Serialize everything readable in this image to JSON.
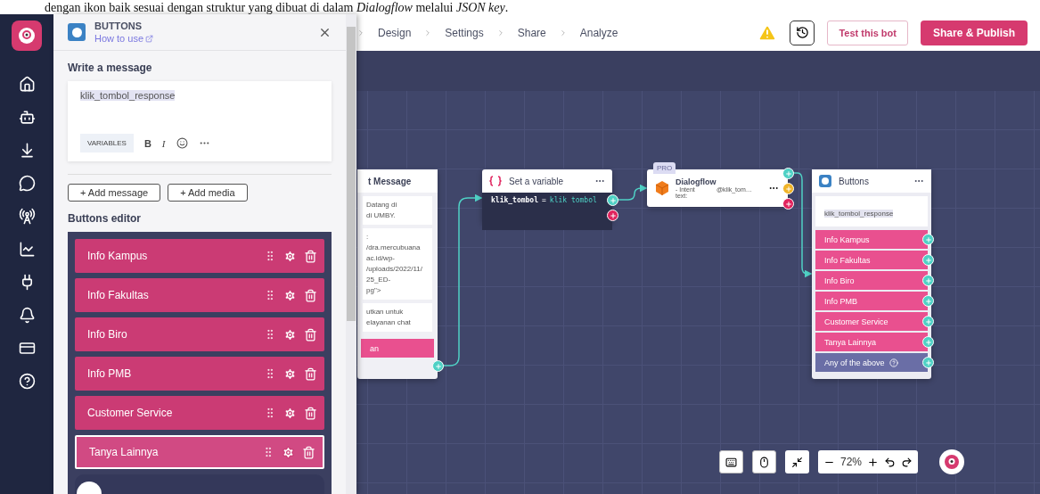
{
  "document_line": "dengan ikon baik sesuai dengan struktur yang dibuat di dalam *Dialogflow* melalui *JSON key*.",
  "topbar": {
    "breadcrumbs": [
      "Design",
      "Settings",
      "Share",
      "Analyze"
    ],
    "test_button": "Test this bot",
    "publish_button": "Share & Publish"
  },
  "panel": {
    "title": "BUTTONS",
    "help_link": "How to use",
    "message_label": "Write a message",
    "message": "klik_tombol_response",
    "format_bar": {
      "variables": "VARIABLES",
      "bold": "B",
      "italic": "I"
    },
    "add_buttons": [
      "+ Add message",
      "+ Add media"
    ],
    "editor_label": "Buttons editor",
    "buttons": [
      {
        "label": "Info Kampus",
        "selected": false
      },
      {
        "label": "Info Fakultas",
        "selected": false
      },
      {
        "label": "Info Biro",
        "selected": false
      },
      {
        "label": "Info PMB",
        "selected": false
      },
      {
        "label": "Customer Service",
        "selected": false
      },
      {
        "label": "Tanya Lainnya",
        "selected": true
      }
    ]
  },
  "canvas": {
    "text_node": {
      "title": "t Message",
      "blocks": [
        "Datang di\ndi UMBY.",
        ":\n/dra.mercubuana\nac.id/wp-\n/uploads/2022/11/\n25_ED-\npg\">",
        "utkan untuk\nelayanan chat"
      ],
      "button": "an"
    },
    "set_variable": {
      "title": "Set a variable",
      "name": "klik_tombol",
      "operator": "=",
      "value": "klik tombol"
    },
    "dialogflow": {
      "badge": "PRO",
      "title": "Dialogflow",
      "intent_label": "- Intent text:",
      "intent_value": "@klik_tom…"
    },
    "buttons_node": {
      "title": "Buttons",
      "message": "klik_tombol_response",
      "options": [
        "Info Kampus",
        "Info Fakultas",
        "Info Biro",
        "Info PMB",
        "Customer Service",
        "Tanya Lainnya"
      ],
      "fallback": "Any of the above"
    }
  },
  "zoom": {
    "reading": "72%"
  }
}
